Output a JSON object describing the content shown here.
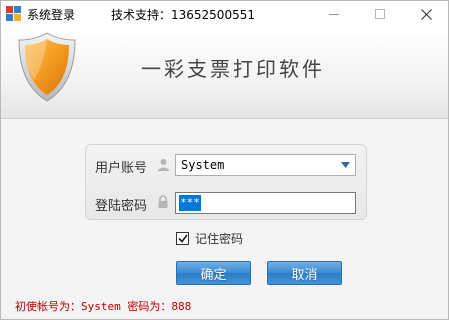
{
  "titlebar": {
    "title": "系统登录",
    "support": "技术支持：13652500551"
  },
  "banner": {
    "app_title": "一彩支票打印软件"
  },
  "form": {
    "username_label": "用户账号",
    "username_value": "System",
    "password_label": "登陆密码",
    "password_masked": "***",
    "remember_label": "记住密码",
    "remember_checked": true
  },
  "buttons": {
    "ok": "确定",
    "cancel": "取消"
  },
  "hint": "初使帐号为：System 密码为：888",
  "icons": {
    "app": "app-logo-icon",
    "shield": "shield-icon",
    "user": "person-icon",
    "lock": "lock-icon",
    "dropdown": "chevron-down-icon",
    "check": "checkmark-icon"
  },
  "colors": {
    "button_blue": "#3b8bd3",
    "hint_red": "#c00000",
    "selection_blue": "#0078d7",
    "shield_orange": "#f29a1f"
  }
}
